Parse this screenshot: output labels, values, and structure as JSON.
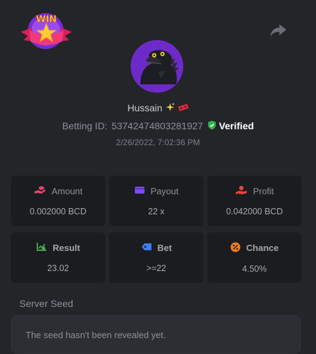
{
  "win_badge": {
    "text": "WIN"
  },
  "user": {
    "name": "Hussain",
    "betting_id_label": "Betting ID:",
    "betting_id": "53742474803281927",
    "verified_label": "Verified",
    "timestamp": "2/26/2022, 7:02:36 PM"
  },
  "stats": {
    "amount": {
      "label": "Amount",
      "value": "0.002000 BCD",
      "icon": "coins-hand-icon",
      "color": "#e8466d"
    },
    "payout": {
      "label": "Payout",
      "value": "22 x",
      "icon": "wallet-icon",
      "color": "#7b4df0"
    },
    "profit": {
      "label": "Profit",
      "value": "0.042000 BCD",
      "icon": "profit-hand-icon",
      "color": "#e0463f"
    },
    "result": {
      "label": "Result",
      "value": "23.02",
      "icon": "chart-check-icon",
      "color": "#47b34a"
    },
    "bet": {
      "label": "Bet",
      "value": ">=22",
      "icon": "tag-icon",
      "color": "#3c7ef0"
    },
    "chance": {
      "label": "Chance",
      "value": "4.50%",
      "icon": "percent-icon",
      "color": "#f07a1f"
    }
  },
  "server_seed": {
    "label": "Server Seed",
    "text": "The seed hasn't been revealed yet."
  }
}
